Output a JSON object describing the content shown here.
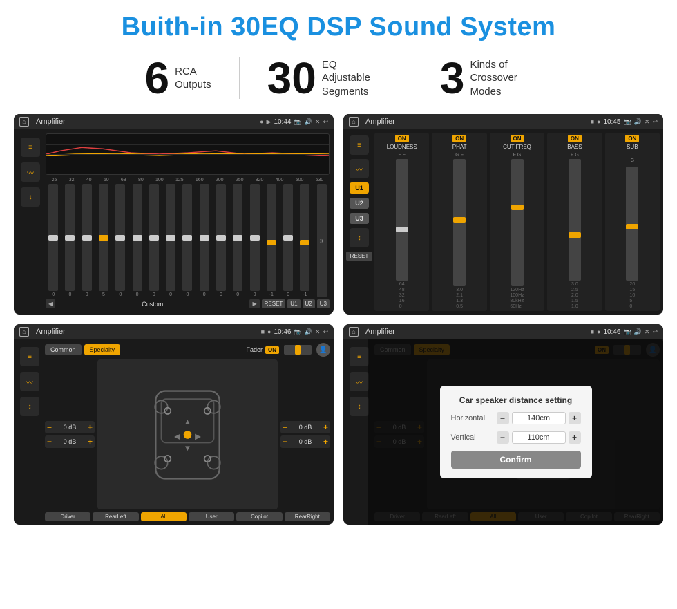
{
  "page": {
    "title": "Buith-in 30EQ DSP Sound System",
    "bg_color": "#ffffff"
  },
  "stats": [
    {
      "number": "6",
      "line1": "RCA",
      "line2": "Outputs"
    },
    {
      "number": "30",
      "line1": "EQ Adjustable",
      "line2": "Segments"
    },
    {
      "number": "3",
      "line1": "Kinds of",
      "line2": "Crossover Modes"
    }
  ],
  "screens": [
    {
      "id": "eq-screen",
      "status_bar": {
        "title": "Amplifier",
        "time": "10:44"
      },
      "preset": "Custom",
      "buttons": [
        "RESET",
        "U1",
        "U2",
        "U3"
      ],
      "freq_labels": [
        "25",
        "32",
        "40",
        "50",
        "63",
        "80",
        "100",
        "125",
        "160",
        "200",
        "250",
        "320",
        "400",
        "500",
        "630"
      ],
      "slider_vals": [
        "0",
        "0",
        "0",
        "5",
        "0",
        "0",
        "0",
        "0",
        "0",
        "0",
        "0",
        "0",
        "0",
        "-1",
        "0",
        "-1"
      ]
    },
    {
      "id": "crossover-screen",
      "status_bar": {
        "title": "Amplifier",
        "time": "10:45"
      },
      "u_buttons": [
        "U1",
        "U2",
        "U3"
      ],
      "on_labels": [
        "ON",
        "ON",
        "ON",
        "ON",
        "ON"
      ],
      "col_labels": [
        "LOUDNESS",
        "PHAT",
        "CUT FREQ",
        "BASS",
        "SUB"
      ],
      "reset": "RESET"
    },
    {
      "id": "fader-screen",
      "status_bar": {
        "title": "Amplifier",
        "time": "10:46"
      },
      "tabs": [
        "Common",
        "Specialty"
      ],
      "fader_label": "Fader",
      "fader_on": "ON",
      "vol_values": [
        "0 dB",
        "0 dB",
        "0 dB",
        "0 dB"
      ],
      "car_buttons": [
        "Driver",
        "All",
        "Copilot",
        "RearLeft",
        "User",
        "RearRight"
      ]
    },
    {
      "id": "dialog-screen",
      "status_bar": {
        "title": "Amplifier",
        "time": "10:46"
      },
      "tabs": [
        "Common",
        "Specialty"
      ],
      "dialog": {
        "title": "Car speaker distance setting",
        "fields": [
          {
            "label": "Horizontal",
            "value": "140cm"
          },
          {
            "label": "Vertical",
            "value": "110cm"
          }
        ],
        "confirm_label": "Confirm"
      },
      "vol_values": [
        "0 dB",
        "0 dB"
      ],
      "car_buttons": [
        "Driver",
        "Copilot",
        "RearLeft",
        "All",
        "User",
        "RearRight"
      ]
    }
  ]
}
